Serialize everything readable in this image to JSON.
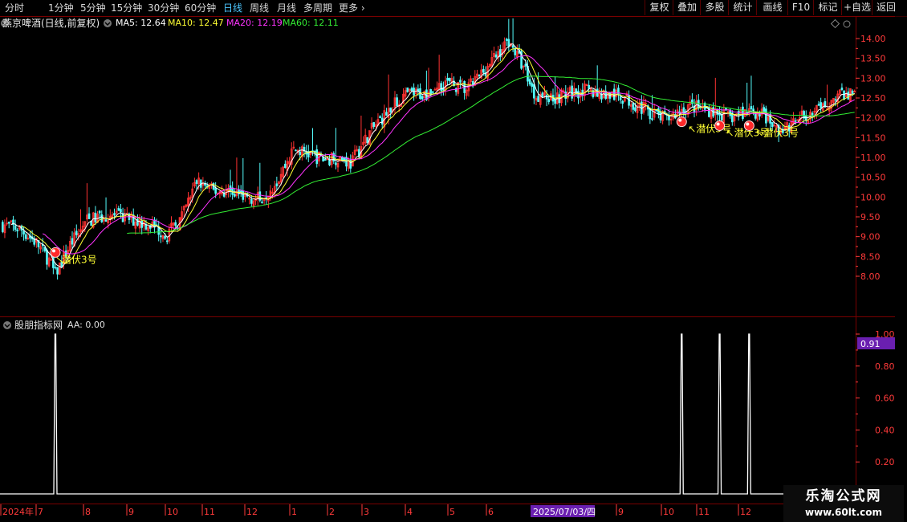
{
  "toolbar": {
    "periods": [
      {
        "label": "分时"
      },
      {
        "label": "1分钟"
      },
      {
        "label": "5分钟"
      },
      {
        "label": "15分钟"
      },
      {
        "label": "30分钟"
      },
      {
        "label": "60分钟"
      },
      {
        "label": "日线",
        "active": true
      },
      {
        "label": "周线"
      },
      {
        "label": "月线"
      },
      {
        "label": "多周期"
      },
      {
        "label": "更多"
      }
    ],
    "more_arrow": "›",
    "right_buttons": [
      "复权",
      "叠加",
      "多股",
      "统计",
      "画线",
      "F10",
      "标记",
      "+自选",
      "返回"
    ]
  },
  "main_header": {
    "stock": "燕京啤酒(日线,前复权)",
    "ma": [
      {
        "label": "MA5: 12.64",
        "color": "#ffffff"
      },
      {
        "label": "MA10: 12.47",
        "color": "#ffff33"
      },
      {
        "label": "MA20: 12.19",
        "color": "#ff33ff"
      },
      {
        "label": "MA60: 12.11",
        "color": "#33ee33"
      }
    ]
  },
  "sub_header": {
    "name": "股朋指标网",
    "value": "AA: 0.00",
    "cursor_value": "0.91"
  },
  "x_axis": {
    "labels": [
      "2024年",
      "7",
      "8",
      "9",
      "10",
      "11",
      "12",
      "1",
      "2",
      "3",
      "4",
      "5",
      "6",
      "7",
      "9",
      "10",
      "11",
      "12"
    ],
    "cursor_date": "2025/07/03/四"
  },
  "watermark": {
    "line1": "乐淘公式网",
    "line2": "www.60lt.com"
  },
  "colors": {
    "up": "#ff3232",
    "down": "#54fcfc",
    "ma5": "#ffffff",
    "ma10": "#ffff33",
    "ma20": "#ff33ff",
    "ma60": "#33ee33",
    "grid": "#7a0000",
    "axis": "#ff3a3a"
  },
  "chart_data": [
    {
      "type": "candlestick",
      "title": "燕京啤酒(日线,前复权)",
      "ylim": [
        7.7,
        14.3
      ],
      "y_ticks": [
        8.0,
        8.5,
        9.0,
        9.5,
        10.0,
        10.5,
        11.0,
        11.5,
        12.0,
        12.5,
        13.0,
        13.5,
        14.0
      ],
      "price_path": [
        [
          0,
          9.3
        ],
        [
          8,
          9.2
        ],
        [
          16,
          8.85
        ],
        [
          22,
          8.4
        ],
        [
          25,
          8.05
        ],
        [
          32,
          8.8
        ],
        [
          40,
          9.4
        ],
        [
          50,
          9.55
        ],
        [
          60,
          9.45
        ],
        [
          70,
          9.3
        ],
        [
          78,
          9.05
        ],
        [
          85,
          9.5
        ],
        [
          92,
          10.4
        ],
        [
          100,
          10.15
        ],
        [
          108,
          10.15
        ],
        [
          116,
          10.0
        ],
        [
          122,
          9.95
        ],
        [
          130,
          10.4
        ],
        [
          138,
          11.2
        ],
        [
          145,
          11.1
        ],
        [
          152,
          10.95
        ],
        [
          160,
          11.0
        ],
        [
          165,
          10.85
        ],
        [
          175,
          11.7
        ],
        [
          185,
          12.3
        ],
        [
          192,
          12.6
        ],
        [
          200,
          12.6
        ],
        [
          210,
          12.9
        ],
        [
          220,
          12.7
        ],
        [
          230,
          13.3
        ],
        [
          240,
          13.95
        ],
        [
          248,
          13.2
        ],
        [
          252,
          12.6
        ],
        [
          260,
          12.5
        ],
        [
          275,
          12.7
        ],
        [
          285,
          12.6
        ],
        [
          295,
          12.5
        ],
        [
          305,
          12.2
        ],
        [
          315,
          11.95
        ],
        [
          320,
          12.15
        ],
        [
          325,
          12.3
        ],
        [
          335,
          12.2
        ],
        [
          345,
          12.0
        ],
        [
          355,
          12.2
        ],
        [
          360,
          12.1
        ],
        [
          365,
          11.8
        ],
        [
          370,
          11.65
        ],
        [
          378,
          12.0
        ],
        [
          388,
          12.2
        ],
        [
          395,
          12.55
        ],
        [
          400,
          12.6
        ],
        [
          404,
          12.65
        ]
      ],
      "ma_last": {
        "MA5": 12.64,
        "MA10": 12.47,
        "MA20": 12.19,
        "MA60": 12.11
      },
      "signals": [
        {
          "label": "潜伏3号",
          "bar": 25,
          "price": 8.6
        },
        {
          "label": "潜伏3号",
          "bar": 322,
          "price": 11.9
        },
        {
          "label": "潜伏3号",
          "bar": 340,
          "price": 11.8
        },
        {
          "label": "潜伏3号",
          "bar": 354,
          "price": 11.8
        }
      ]
    },
    {
      "type": "line",
      "title": "股朋指标网",
      "ylim": [
        0,
        1.0
      ],
      "y_ticks": [
        0.2,
        0.4,
        0.6,
        0.8,
        1.0
      ],
      "series": [
        {
          "name": "AA",
          "spikes": [
            25,
            322,
            340,
            354
          ],
          "value": 1.0
        }
      ]
    }
  ]
}
